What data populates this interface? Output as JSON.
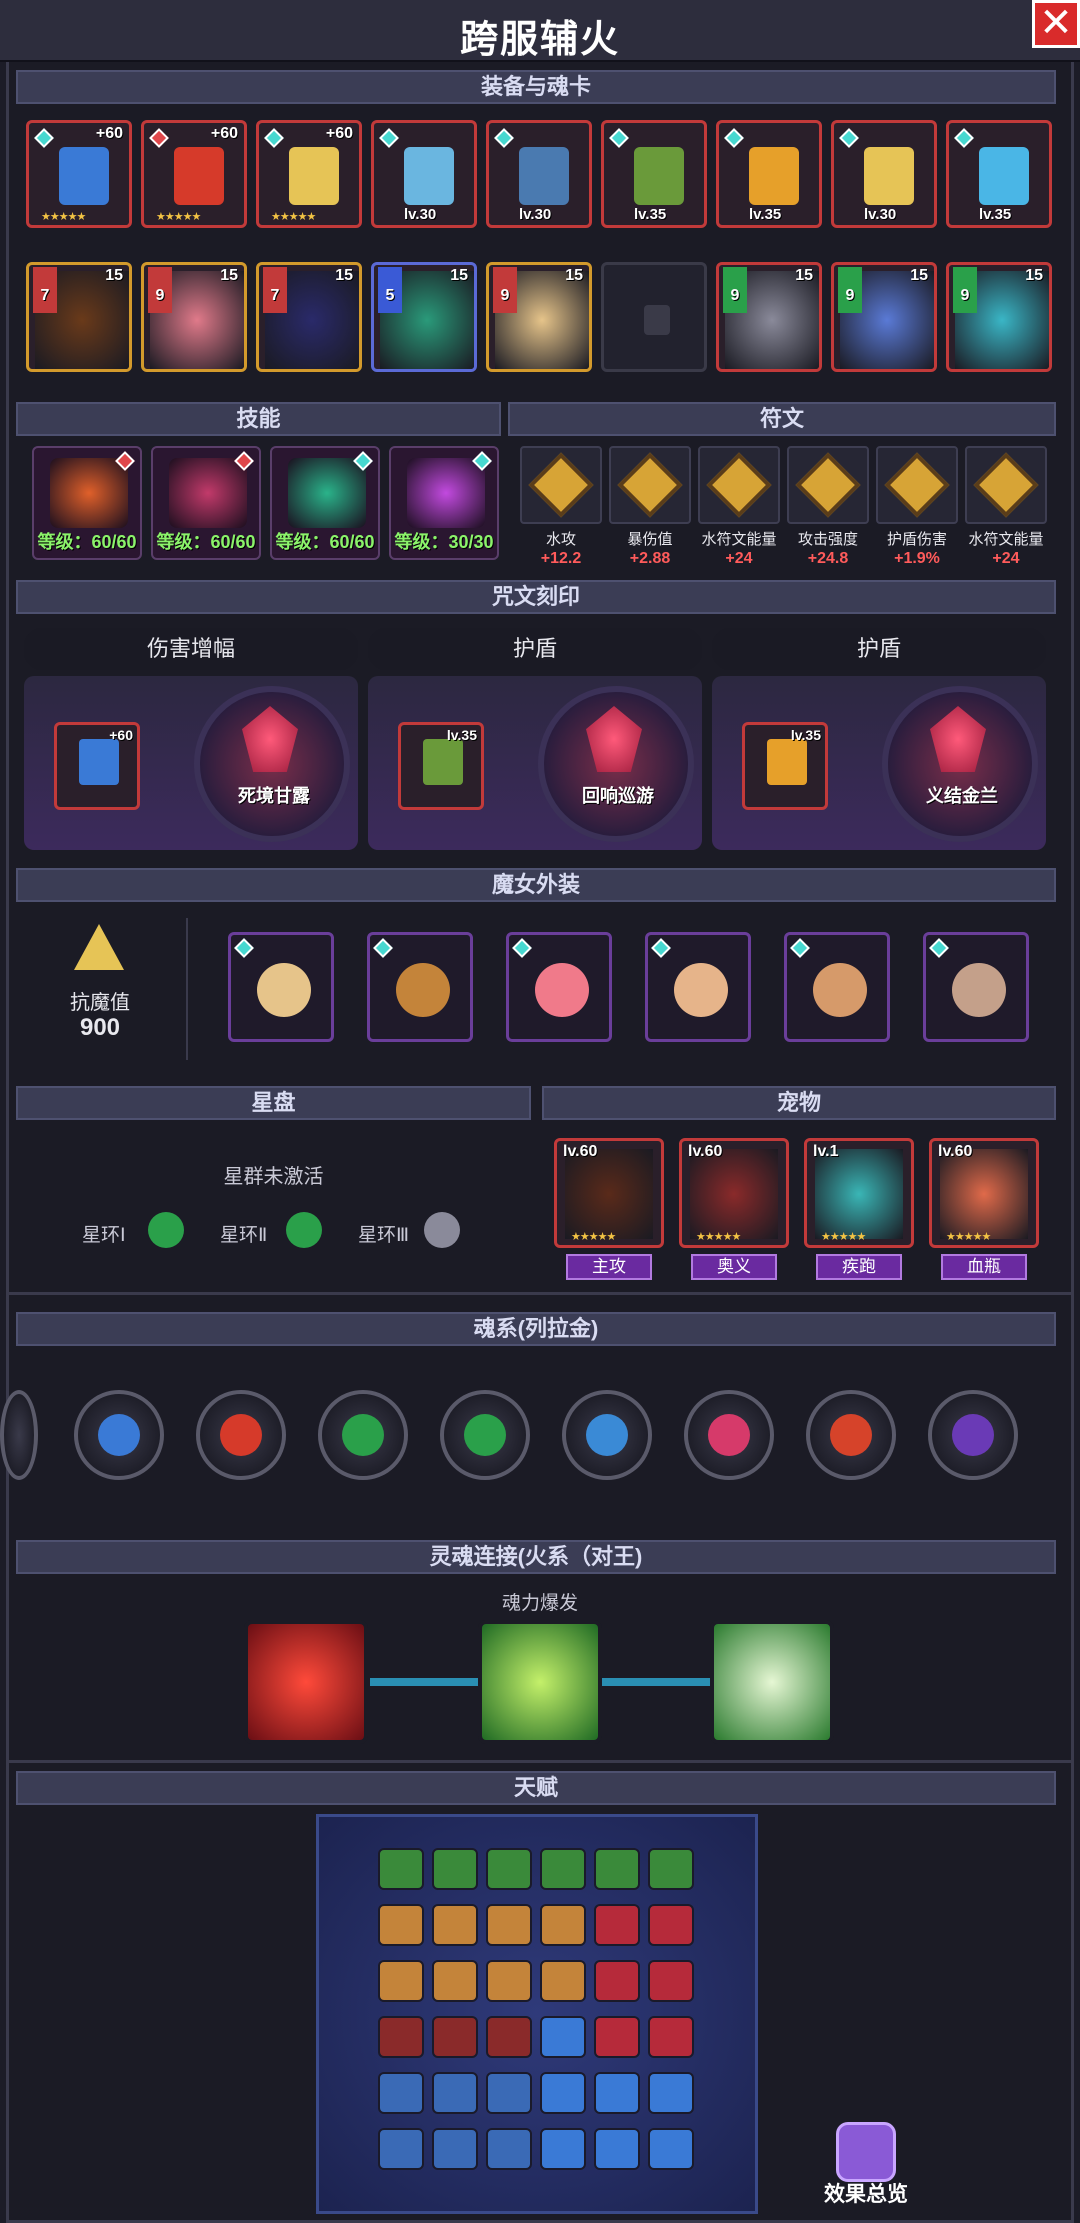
{
  "title": "跨服辅火",
  "close_icon": "close-icon",
  "sections": {
    "equipment": "装备与魂卡",
    "skills": "技能",
    "runes": "符文",
    "curse": "咒文刻印",
    "costume": "魔女外装",
    "star": "星盘",
    "pet": "宠物",
    "soul": "魂系(列拉金)",
    "link": "灵魂连接(火系（对王)",
    "talent": "天赋"
  },
  "equipment": [
    {
      "tag": "+60",
      "kind": "red",
      "icon": "shield-icon",
      "gem": "teal"
    },
    {
      "tag": "+60",
      "kind": "red",
      "icon": "sword-icon",
      "gem": "red"
    },
    {
      "tag": "+60",
      "kind": "red",
      "icon": "crown-icon",
      "gem": "teal"
    },
    {
      "tag": "lv.30",
      "kind": "red",
      "icon": "helmet-icon",
      "gem": "blue"
    },
    {
      "tag": "lv.30",
      "kind": "red",
      "icon": "armor-icon",
      "gem": "blue"
    },
    {
      "tag": "lv.35",
      "kind": "red",
      "icon": "glove-icon",
      "gem": "blue"
    },
    {
      "tag": "lv.35",
      "kind": "red",
      "icon": "ring-icon",
      "gem": "blue"
    },
    {
      "tag": "lv.30",
      "kind": "red",
      "icon": "amulet-icon",
      "gem": "blue"
    },
    {
      "tag": "lv.35",
      "kind": "red",
      "icon": "boots-icon",
      "gem": "blue"
    }
  ],
  "soulcards": [
    {
      "star": "7",
      "lv": "15",
      "border": "gold"
    },
    {
      "star": "9",
      "lv": "15",
      "border": "gold"
    },
    {
      "star": "7",
      "lv": "15",
      "border": "gold"
    },
    {
      "star": "5",
      "lv": "15",
      "border": "blue"
    },
    {
      "star": "9",
      "lv": "15",
      "border": "gold"
    },
    {
      "star": "",
      "lv": "",
      "border": "empty"
    },
    {
      "star": "9",
      "lv": "15",
      "border": "red"
    },
    {
      "star": "9",
      "lv": "15",
      "border": "red"
    },
    {
      "star": "9",
      "lv": "15",
      "border": "red"
    }
  ],
  "skills": [
    {
      "label": "等级：60/60",
      "color": "#e0602a"
    },
    {
      "label": "等级：60/60",
      "color": "#c23a6a"
    },
    {
      "label": "等级：60/60",
      "color": "#2ab38a"
    },
    {
      "label": "等级：30/30",
      "color": "#c24adf"
    }
  ],
  "runes": [
    {
      "name": "水攻",
      "value": "+12.2"
    },
    {
      "name": "暴伤值",
      "value": "+2.88"
    },
    {
      "name": "水符文能量",
      "value": "+24"
    },
    {
      "name": "攻击强度",
      "value": "+24.8"
    },
    {
      "name": "护盾伤害",
      "value": "+1.9%"
    },
    {
      "name": "水符文能量",
      "value": "+24"
    }
  ],
  "curses": [
    {
      "header": "伤害增幅",
      "tag": "+60",
      "name": "死境甘露"
    },
    {
      "header": "护盾",
      "tag": "lv.35",
      "name": "回响巡游"
    },
    {
      "header": "护盾",
      "tag": "lv.35",
      "name": "义结金兰"
    }
  ],
  "costume": {
    "resist_label": "抗魔值",
    "resist_value": "900"
  },
  "star": {
    "status": "星群未激活",
    "rings": [
      "星环Ⅰ",
      "星环Ⅱ",
      "星环Ⅲ"
    ]
  },
  "pets": [
    {
      "lv": "lv.60",
      "role": "主攻"
    },
    {
      "lv": "lv.60",
      "role": "奥义"
    },
    {
      "lv": "lv.1",
      "role": "疾跑"
    },
    {
      "lv": "lv.60",
      "role": "血瓶"
    }
  ],
  "link": {
    "label": "魂力爆发"
  },
  "talent": {
    "overview": "效果总览"
  },
  "colors": {
    "accent_red": "#c23a3a",
    "rune_value": "#ff5b5b",
    "skill_level": "#8bf36a",
    "header_bg": "#3b3d55"
  }
}
